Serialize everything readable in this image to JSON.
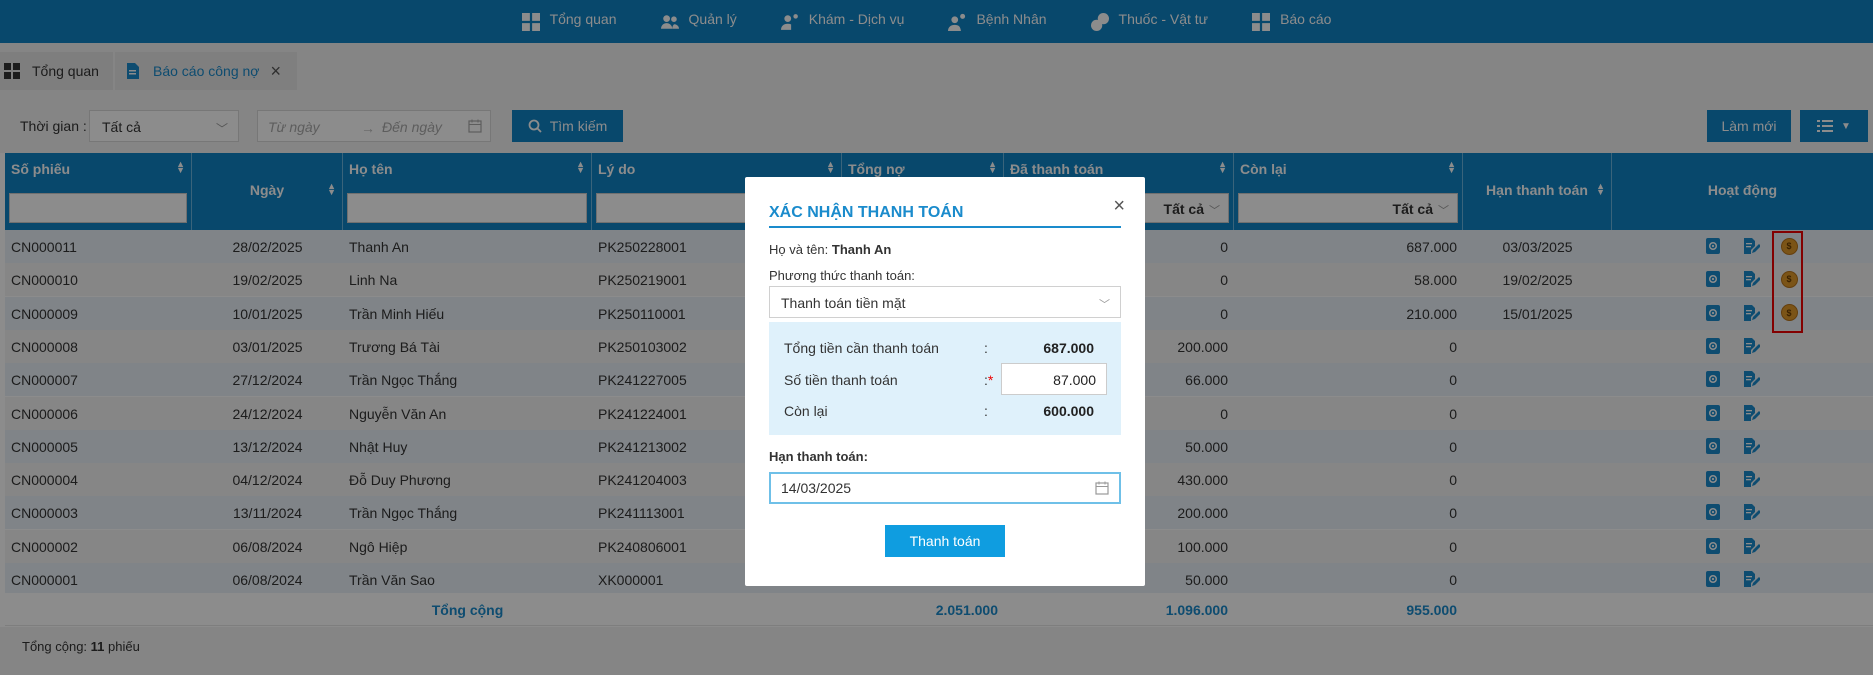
{
  "nav": [
    {
      "label": "Tổng quan",
      "icon": "grid-icon"
    },
    {
      "label": "Quản lý",
      "icon": "users-icon"
    },
    {
      "label": "Khám - Dịch vụ",
      "icon": "user-settings-icon"
    },
    {
      "label": "Bệnh Nhân",
      "icon": "user-gear-icon"
    },
    {
      "label": "Thuốc - Vật tư",
      "icon": "medicine-icon"
    },
    {
      "label": "Báo cáo",
      "icon": "grid-icon"
    }
  ],
  "tabs": [
    {
      "label": "Tổng quan"
    },
    {
      "label": "Báo cáo công nợ"
    }
  ],
  "filters": {
    "time_label": "Thời gian :",
    "time_value": "Tất cả",
    "from_placeholder": "Từ ngày",
    "to_placeholder": "Đến ngày",
    "search_label": "Tìm kiếm",
    "new_label": "Làm mới"
  },
  "columns": {
    "so_phieu": "Số phiếu",
    "ngay": "Ngày",
    "ho_ten": "Họ tên",
    "ly_do": "Lý do",
    "tong_no": "Tổng nợ",
    "da_tt": "Đã thanh toán",
    "con_lai": "Còn lại",
    "han_tt": "Hạn thanh toán",
    "hoat_dong": "Hoạt động",
    "filter_all_1": "Tất cả",
    "filter_all_2": "Tất cả"
  },
  "rows": [
    {
      "so": "CN000011",
      "ngay": "28/02/2025",
      "ten": "Thanh An",
      "lydo": "PK250228001",
      "datt": "0",
      "conlai": "687.000",
      "han": "03/03/2025",
      "pay": true
    },
    {
      "so": "CN000010",
      "ngay": "19/02/2025",
      "ten": "Linh Na",
      "lydo": "PK250219001",
      "datt": "0",
      "conlai": "58.000",
      "han": "19/02/2025",
      "pay": true
    },
    {
      "so": "CN000009",
      "ngay": "10/01/2025",
      "ten": "Trần Minh Hiếu",
      "lydo": "PK250110001",
      "datt": "0",
      "conlai": "210.000",
      "han": "15/01/2025",
      "pay": true
    },
    {
      "so": "CN000008",
      "ngay": "03/01/2025",
      "ten": "Trương Bá Tài",
      "lydo": "PK250103002",
      "datt": "200.000",
      "conlai": "0",
      "han": "",
      "pay": false
    },
    {
      "so": "CN000007",
      "ngay": "27/12/2024",
      "ten": "Trần Ngọc Thắng",
      "lydo": "PK241227005",
      "datt": "66.000",
      "conlai": "0",
      "han": "",
      "pay": false
    },
    {
      "so": "CN000006",
      "ngay": "24/12/2024",
      "ten": "Nguyễn Văn An",
      "lydo": "PK241224001",
      "datt": "0",
      "conlai": "0",
      "han": "",
      "pay": false
    },
    {
      "so": "CN000005",
      "ngay": "13/12/2024",
      "ten": "Nhật Huy",
      "lydo": "PK241213002",
      "datt": "50.000",
      "conlai": "0",
      "han": "",
      "pay": false
    },
    {
      "so": "CN000004",
      "ngay": "04/12/2024",
      "ten": "Đỗ Duy Phương",
      "lydo": "PK241204003",
      "datt": "430.000",
      "conlai": "0",
      "han": "",
      "pay": false
    },
    {
      "so": "CN000003",
      "ngay": "13/11/2024",
      "ten": "Trần Ngọc Thắng",
      "lydo": "PK241113001",
      "datt": "200.000",
      "conlai": "0",
      "han": "",
      "pay": false
    },
    {
      "so": "CN000002",
      "ngay": "06/08/2024",
      "ten": "Ngô Hiệp",
      "lydo": "PK240806001",
      "datt": "100.000",
      "conlai": "0",
      "han": "",
      "pay": false
    },
    {
      "so": "CN000001",
      "ngay": "06/08/2024",
      "ten": "Trần Văn Sao",
      "lydo": "XK000001",
      "datt": "50.000",
      "conlai": "0",
      "han": "",
      "pay": false
    }
  ],
  "totals": {
    "label": "Tổng cộng",
    "tong_no": "2.051.000",
    "da_tt": "1.096.000",
    "con_lai": "955.000"
  },
  "summary": {
    "prefix": "Tổng cộng: ",
    "count": "11",
    "suffix": " phiếu"
  },
  "modal": {
    "title": "XÁC NHẬN THANH TOÁN",
    "name_label": "Họ và tên: ",
    "name_value": "Thanh An",
    "method_label": "Phương thức thanh toán:",
    "method_value": "Thanh toán tiền mặt",
    "total_label": "Tổng tiền cần thanh toán",
    "total_value": "687.000",
    "amount_label": "Số tiền thanh toán",
    "amount_value": "87.000",
    "remain_label": "Còn lại",
    "remain_value": "600.000",
    "due_label": "Hạn thanh toán:",
    "due_value": "14/03/2025",
    "pay_label": "Thanh toán"
  }
}
